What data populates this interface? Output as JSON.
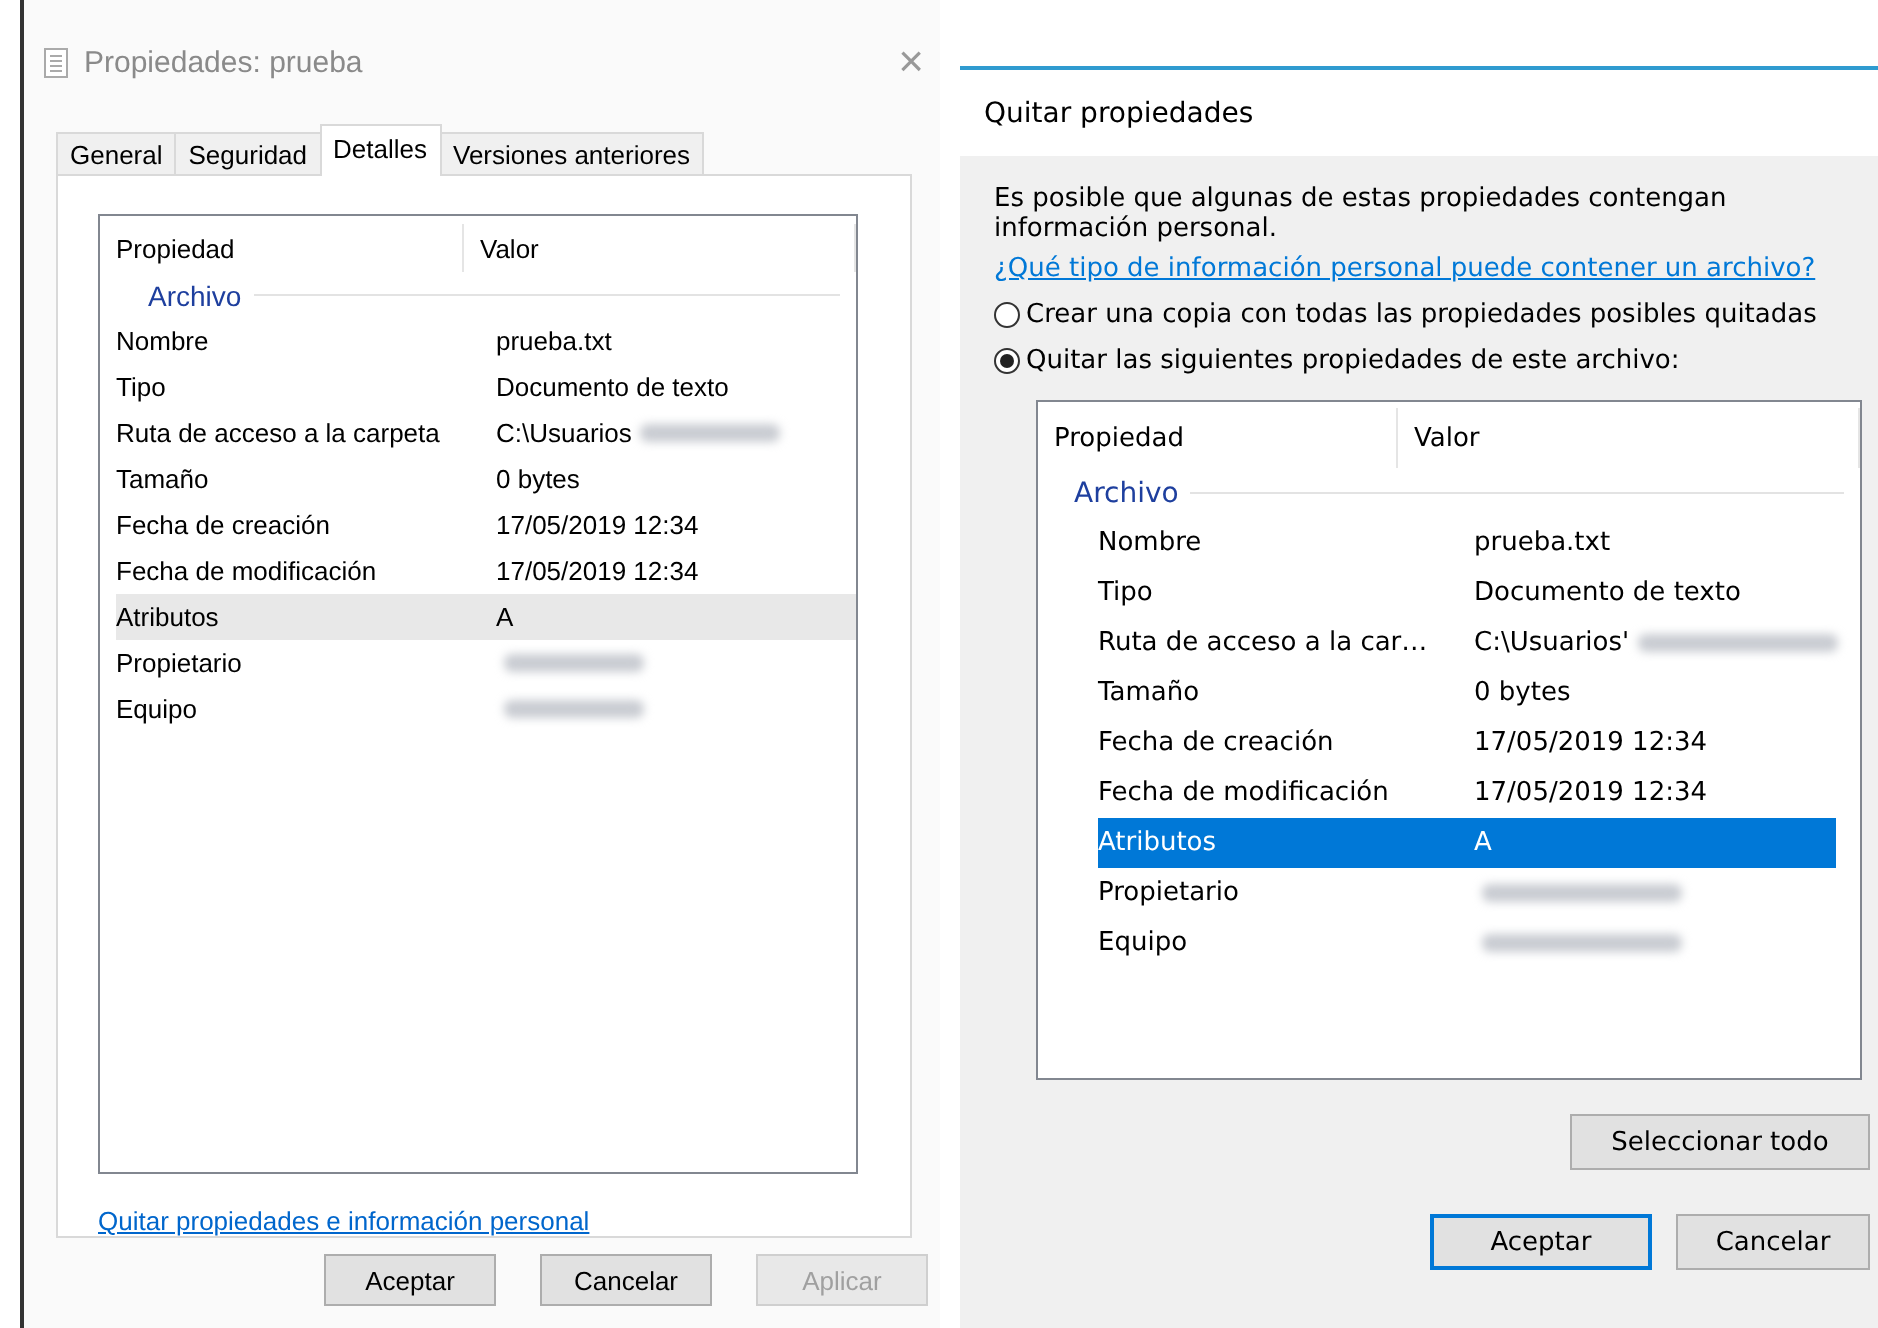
{
  "properties_dialog": {
    "title": "Propiedades: prueba",
    "close": "×",
    "tabs": [
      {
        "label": "General",
        "selected": false
      },
      {
        "label": "Seguridad",
        "selected": false
      },
      {
        "label": "Detalles",
        "selected": true
      },
      {
        "label": "Versiones anteriores",
        "selected": false
      }
    ],
    "list": {
      "focused": false,
      "columns": [
        "Propiedad",
        "Valor"
      ],
      "group": "Archivo",
      "rows": [
        {
          "property": "Nombre",
          "value": "prueba.txt",
          "blurred": false,
          "selected": false
        },
        {
          "property": "Tipo",
          "value": "Documento de texto",
          "blurred": false,
          "selected": false
        },
        {
          "property": "Ruta de acceso a la carpeta",
          "value": "C:\\Usuarios",
          "blurred": true,
          "selected": false
        },
        {
          "property": "Tamaño",
          "value": "0 bytes",
          "blurred": false,
          "selected": false
        },
        {
          "property": "Fecha de creación",
          "value": "17/05/2019 12:34",
          "blurred": false,
          "selected": false
        },
        {
          "property": "Fecha de modificación",
          "value": "17/05/2019 12:34",
          "blurred": false,
          "selected": false
        },
        {
          "property": "Atributos",
          "value": "A",
          "blurred": false,
          "selected": true
        },
        {
          "property": "Propietario",
          "blurred": true,
          "selected": false
        },
        {
          "property": "Equipo",
          "blurred": true,
          "selected": false
        }
      ]
    },
    "link": "Quitar propiedades e información personal",
    "buttons": [
      {
        "label": "Aceptar",
        "disabled": false
      },
      {
        "label": "Cancelar",
        "disabled": false
      },
      {
        "label": "Aplicar",
        "disabled": true
      }
    ]
  },
  "remove_dialog": {
    "title": "Quitar propiedades",
    "description": "Es posible que algunas de estas propiedades contengan información personal.",
    "link": "¿Qué tipo de información personal puede contener un archivo?",
    "options": [
      {
        "label": "Crear una copia con todas las propiedades posibles quitadas",
        "selected": false
      },
      {
        "label": "Quitar las siguientes propiedades de este archivo:",
        "selected": true
      }
    ],
    "list": {
      "focused": true,
      "columns": [
        "Propiedad",
        "Valor"
      ],
      "group": "Archivo",
      "rows": [
        {
          "property": "Nombre",
          "value": "prueba.txt",
          "blurred": false,
          "selected": false
        },
        {
          "property": "Tipo",
          "value": "Documento de texto",
          "blurred": false,
          "selected": false
        },
        {
          "property": "Ruta de acceso a la car…",
          "value": "C:\\Usuarios'",
          "blurred": true,
          "selected": false
        },
        {
          "property": "Tamaño",
          "value": "0 bytes",
          "blurred": false,
          "selected": false
        },
        {
          "property": "Fecha de creación",
          "value": "17/05/2019 12:34",
          "blurred": false,
          "selected": false
        },
        {
          "property": "Fecha de modificación",
          "value": "17/05/2019 12:34",
          "blurred": false,
          "selected": false
        },
        {
          "property": "Atributos",
          "value": "A",
          "blurred": false,
          "selected": true
        },
        {
          "property": "Propietario",
          "blurred": true,
          "selected": false
        },
        {
          "property": "Equipo",
          "blurred": true,
          "selected": false
        }
      ]
    },
    "select_all": "Seleccionar todo",
    "buttons": [
      {
        "label": "Aceptar",
        "default": true
      },
      {
        "label": "Cancelar",
        "default": false
      }
    ]
  }
}
